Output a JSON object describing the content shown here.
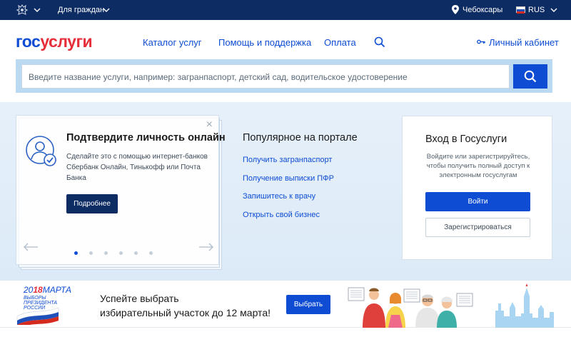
{
  "topbar": {
    "citizen_label": "Для граждан",
    "city": "Чебоксары",
    "lang": "RUS"
  },
  "header": {
    "logo_part1": "гос",
    "logo_part2": "услуги",
    "nav": [
      "Каталог услуг",
      "Помощь и поддержка",
      "Оплата"
    ],
    "cabinet": "Личный кабинет"
  },
  "search": {
    "placeholder": "Введите название услуги, например: загранпаспорт, детский сад, водительское удостоверение"
  },
  "promo_card": {
    "title": "Подтвердите личность онлайн",
    "text": "Сделайте это с помощью интернет-банков Сбербанк Онлайн, Тинькофф или Почта Банка",
    "button": "Подробнее",
    "close": "×",
    "slides": 6,
    "active_slide": 1
  },
  "popular": {
    "title": "Популярное на портале",
    "links": [
      "Получить загранпаспорт",
      "Получение выписки ПФР",
      "Запишитесь к врачу",
      "Открыть свой бизнес"
    ]
  },
  "login": {
    "title": "Вход в Госуслуги",
    "text": "Войдите или зарегистрируйтесь, чтобы получить полный доступ к электронным госуслугам",
    "login_button": "Войти",
    "register_button": "Зарегистрироваться"
  },
  "banner": {
    "year_prefix": "20",
    "year_accent": "18",
    "month": "МАРТА",
    "election_text": "ВЫБОРЫ ПРЕЗИДЕНТА РОССИИ",
    "line1": "Успейте выбрать",
    "line2": "избирательный участок до 12 марта!",
    "button": "Выбрать"
  },
  "colors": {
    "topbar": "#0d2c63",
    "brand_blue": "#0d4cd3",
    "brand_red": "#e62e3a",
    "hero_bg": "#e6f0fa"
  }
}
